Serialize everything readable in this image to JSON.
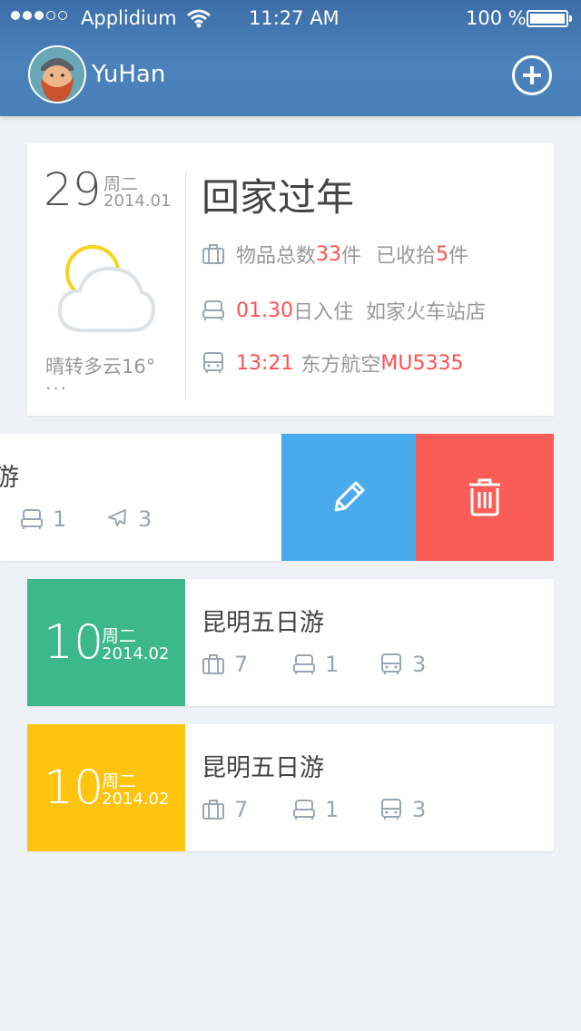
{
  "status_bar": {
    "carrier": "Applidium",
    "time": "11:27 AM",
    "battery": "100 %"
  },
  "header": {
    "username": "YuHan"
  },
  "main_card": {
    "day": "29",
    "weekday": "周二",
    "date": "2014.01",
    "weather": "晴转多云16°",
    "more": "···",
    "title": "回家过年",
    "items_label": "物品总数",
    "items_total": "33",
    "items_unit": "件",
    "packed_label": "已收拾",
    "packed_count": "5",
    "packed_unit": "件",
    "checkin_date": "01.30",
    "checkin_label": "日入住",
    "hotel": "如家火车站店",
    "transport_time": "13:21",
    "flight_airline": "东方航空",
    "flight_no": "MU5335"
  },
  "swipe_card": {
    "title": "昆明五日游",
    "hotel_count": "1",
    "flight_count": "3"
  },
  "list_cards": [
    {
      "day": "10",
      "weekday": "周二",
      "date": "2014.02",
      "title": "昆明五日游",
      "items": "7",
      "hotel": "1",
      "transport": "3",
      "color": "#3cb88b"
    },
    {
      "day": "10",
      "weekday": "周二",
      "date": "2014.02",
      "title": "昆明五日游",
      "items": "7",
      "hotel": "1",
      "transport": "3",
      "color": "#fec40f"
    }
  ],
  "colors": {
    "header": "#4a80b8",
    "red": "#ff5050",
    "edit": "#4aabec",
    "delete": "#f95d55"
  }
}
